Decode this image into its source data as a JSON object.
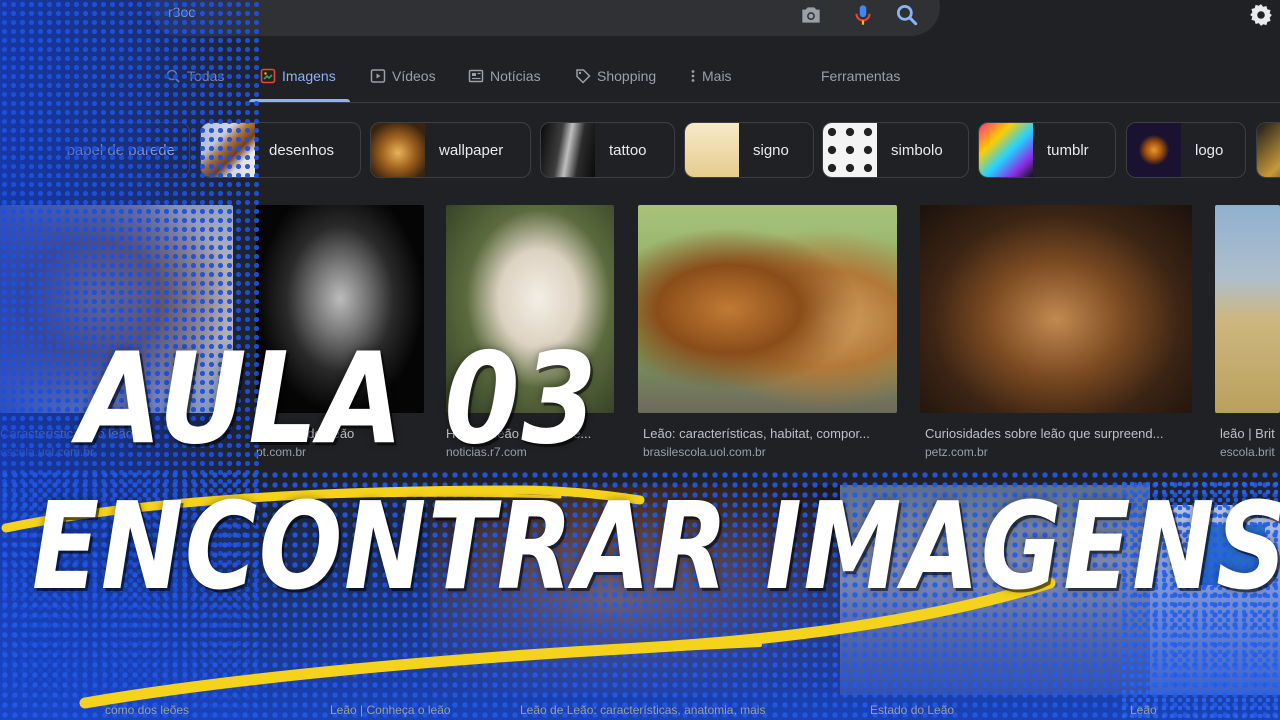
{
  "search": {
    "query": "r3oo"
  },
  "tabs": [
    {
      "label": "Todas",
      "icon": "search-icon"
    },
    {
      "label": "Imagens",
      "icon": "image-icon",
      "active": true
    },
    {
      "label": "Vídeos",
      "icon": "play-icon"
    },
    {
      "label": "Notícias",
      "icon": "newspaper-icon"
    },
    {
      "label": "Shopping",
      "icon": "tag-icon"
    },
    {
      "label": "Mais",
      "icon": "more-vert-icon"
    }
  ],
  "tools_label": "Ferramentas",
  "chips": [
    {
      "label": "papel de parede"
    },
    {
      "label": "desenhos"
    },
    {
      "label": "wallpaper"
    },
    {
      "label": "tattoo"
    },
    {
      "label": "signo"
    },
    {
      "label": "simbolo"
    },
    {
      "label": "tumblr"
    },
    {
      "label": "logo"
    }
  ],
  "results": [
    {
      "caption": "Características do leão",
      "source": "escola.uol.com.br"
    },
    {
      "caption": "O Rosto do Leão",
      "source": "pt.com.br"
    },
    {
      "caption": "Hoya: o leão branco de...",
      "source": "noticias.r7.com"
    },
    {
      "caption": "Leão: características, habitat, compor...",
      "source": "brasilescola.uol.com.br"
    },
    {
      "caption": "Curiosidades sobre leão que surpreend...",
      "source": "petz.com.br"
    },
    {
      "caption": "leão | Brit",
      "source": "escola.brit"
    }
  ],
  "bottom_captions": [
    "como dos leões",
    "Leão | Conheça o leão",
    "Leão de Leão: características, anatomia, mais",
    "Estado do Leão",
    "Leão"
  ],
  "overlay": {
    "line1": "AULA 03",
    "line2": "ENCONTRAR IMAGENS"
  },
  "colors": {
    "background": "#202124",
    "accent": "#8ab4f8",
    "overlay_blue": "#1e50dc",
    "underline_yellow": "#f5d31c",
    "mic_red": "#ea4335",
    "mic_blue": "#4285f4"
  }
}
